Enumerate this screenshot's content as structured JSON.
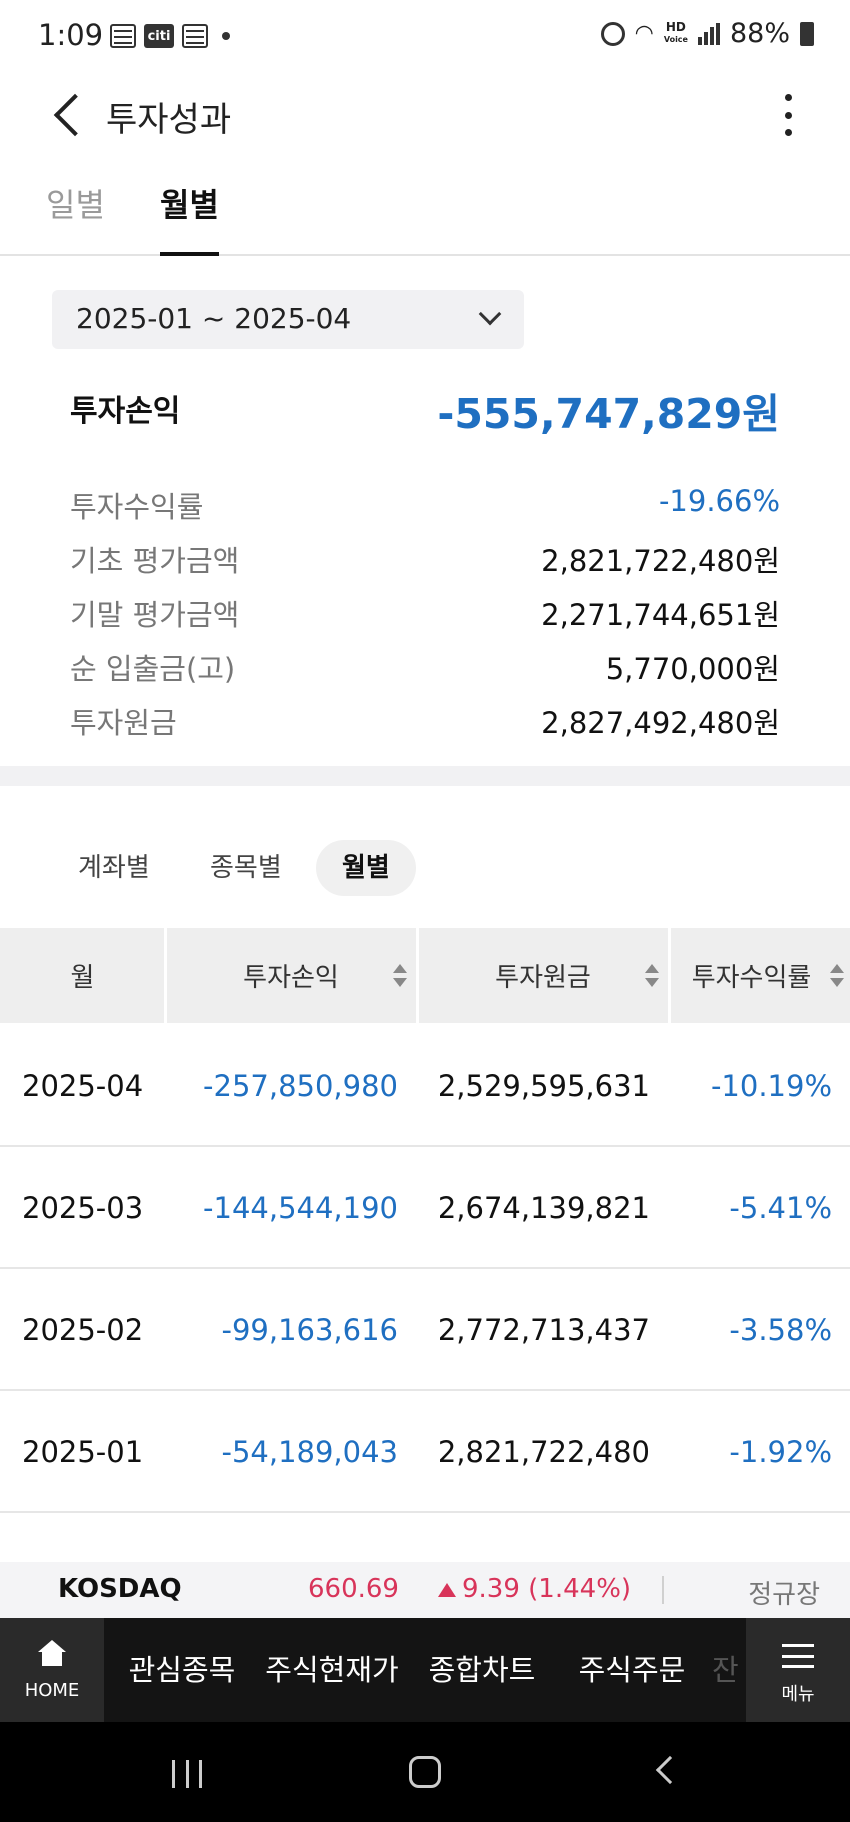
{
  "status_bar": {
    "time": "1:09",
    "battery": "88%",
    "carrier_badge": "citi",
    "hd_label_top": "HD",
    "hd_label_bottom": "Voice"
  },
  "header": {
    "title": "투자성과"
  },
  "top_tabs": {
    "daily": "일별",
    "monthly": "월별",
    "active": "월별"
  },
  "period": {
    "value": "2025-01 ~ 2025-04"
  },
  "summary": {
    "main_label": "투자손익",
    "main_value": "-555,747,829원",
    "rows": [
      {
        "label": "투자수익률",
        "value": "-19.66%"
      },
      {
        "label": "기초 평가금액",
        "value": "2,821,722,480원"
      },
      {
        "label": "기말 평가금액",
        "value": "2,271,744,651원"
      },
      {
        "label": "순 입출금(고)",
        "value": "5,770,000원"
      },
      {
        "label": "투자원금",
        "value": "2,827,492,480원"
      }
    ]
  },
  "segments": {
    "account": "계좌별",
    "stock": "종목별",
    "monthly": "월별",
    "active": "월별"
  },
  "table": {
    "headers": [
      "월",
      "투자손익",
      "투자원금",
      "투자수익률"
    ],
    "rows": [
      {
        "month": "2025-04",
        "pl": "-257,850,980",
        "principal": "2,529,595,631",
        "rate": "-10.19%"
      },
      {
        "month": "2025-03",
        "pl": "-144,544,190",
        "principal": "2,674,139,821",
        "rate": "-5.41%"
      },
      {
        "month": "2025-02",
        "pl": "-99,163,616",
        "principal": "2,772,713,437",
        "rate": "-3.58%"
      },
      {
        "month": "2025-01",
        "pl": "-54,189,043",
        "principal": "2,821,722,480",
        "rate": "-1.92%"
      }
    ]
  },
  "ticker": {
    "name": "KOSDAQ",
    "price": "660.69",
    "change": "9.39 (1.44%)",
    "status": "정규장"
  },
  "bottom_menu": {
    "home": "HOME",
    "items": [
      "관심종목",
      "주식현재가",
      "종합차트",
      "주식주문",
      "잔"
    ],
    "menu": "메뉴"
  },
  "colors": {
    "blue": "#1f6fc1",
    "red": "#d8345a",
    "dark_bar": "#141414"
  }
}
